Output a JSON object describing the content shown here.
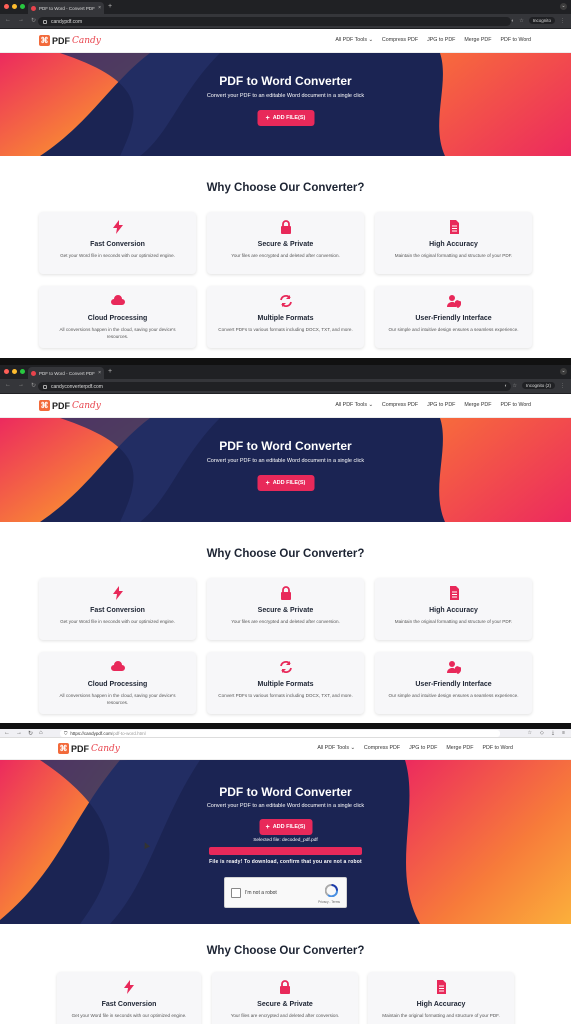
{
  "browser": {
    "tab_title": "PDF to Word - Convert PDF t",
    "tab_close": "×",
    "new_tab": "+",
    "url_1": "candypdf.com",
    "url_2": "candyconverterpdf.com",
    "url_3_host": "https://candypdf.com",
    "url_3_path": "/pdf-to-word.html",
    "incognito_1": "Incognito",
    "incognito_2": "Incognito (2)"
  },
  "logo": {
    "pdf": "PDF",
    "candy": "Candy"
  },
  "nav": {
    "items": [
      {
        "label": "All PDF Tools ⌄"
      },
      {
        "label": "Compress PDF"
      },
      {
        "label": "JPG to PDF"
      },
      {
        "label": "Merge PDF"
      },
      {
        "label": "PDF to Word"
      }
    ]
  },
  "hero": {
    "title": "PDF to Word Converter",
    "subtitle": "Convert your PDF to an editable Word document in a single click",
    "button_plus": "+",
    "button_label": "ADD FILE(S)",
    "selected_file": "Selected file: decoded_pdf.pdf",
    "ready_text": "File is ready! To download, confirm that you are not a robot",
    "recaptcha_label": "I'm not a robot",
    "recaptcha_terms": "Privacy - Terms"
  },
  "features": {
    "heading": "Why Choose Our Converter?",
    "cards": [
      {
        "icon": "bolt-icon",
        "title": "Fast Conversion",
        "desc": "Get your Word file in seconds with our optimized engine."
      },
      {
        "icon": "lock-icon",
        "title": "Secure & Private",
        "desc": "Your files are encrypted and deleted after conversion."
      },
      {
        "icon": "document-icon",
        "title": "High Accuracy",
        "desc": "Maintain the original formatting and structure of your PDF."
      },
      {
        "icon": "cloud-icon",
        "title": "Cloud Processing",
        "desc": "All conversions happen in the cloud, saving your device's resources."
      },
      {
        "icon": "refresh-icon",
        "title": "Multiple Formats",
        "desc": "Convert PDFs to various formats including DOCX, TXT, and more."
      },
      {
        "icon": "user-shield-icon",
        "title": "User-Friendly Interface",
        "desc": "Our simple and intuitive design ensures a seamless experience."
      }
    ]
  },
  "colors": {
    "accent": "#e8295a",
    "hero_navy": "#1b2453",
    "hero_orange": "#f7a23a",
    "hero_pink": "#ec2a5e"
  }
}
